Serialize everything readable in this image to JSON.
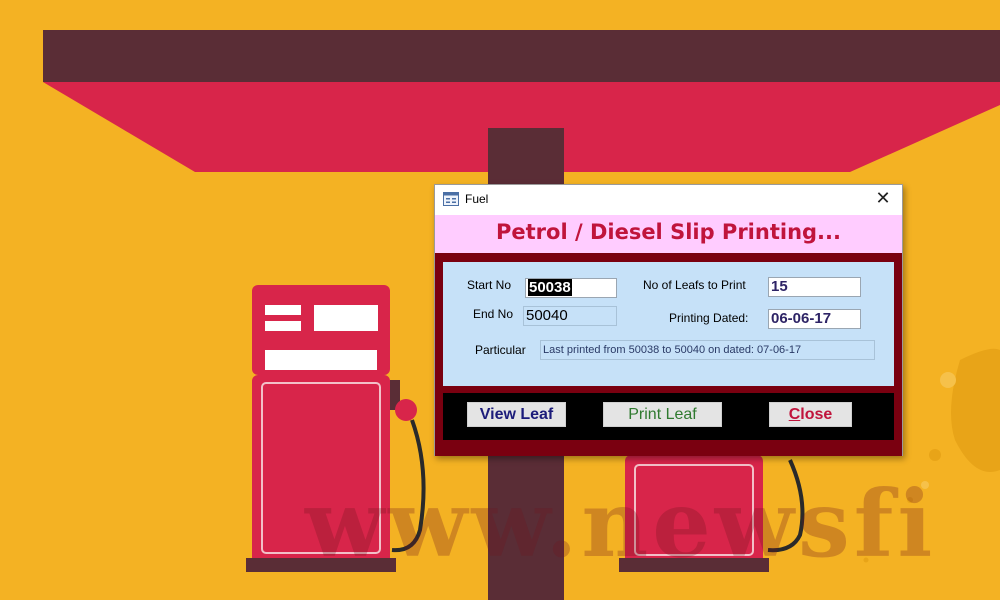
{
  "window": {
    "title": "Fuel",
    "close_glyph": "✕"
  },
  "header": {
    "title": "Petrol / Diesel Slip Printing..."
  },
  "form": {
    "start_no_label": "Start No",
    "start_no_value": "50038",
    "end_no_label": "End No",
    "end_no_value": "50040",
    "leafs_label": "No of Leafs to Print",
    "leafs_value": "15",
    "dated_label": "Printing Dated:",
    "dated_value": "06-06-17",
    "particular_label": "Particular",
    "particular_value": "Last printed from 50038 to 50040 on dated: 07-06-17"
  },
  "buttons": {
    "view_leaf": "View Leaf",
    "print_leaf": "Print Leaf",
    "close_hotkey": "C",
    "close_rest": "lose"
  },
  "watermark": {
    "text": "www.newsfi"
  },
  "colors": {
    "background": "#f4b223",
    "canopy_top": "#5a2d36",
    "canopy": "#d8254a",
    "pump": "#d8254a",
    "header_bg": "#ffccff",
    "header_text": "#c0143c",
    "frame": "#7a0010",
    "panel": "#c6e1f8"
  }
}
